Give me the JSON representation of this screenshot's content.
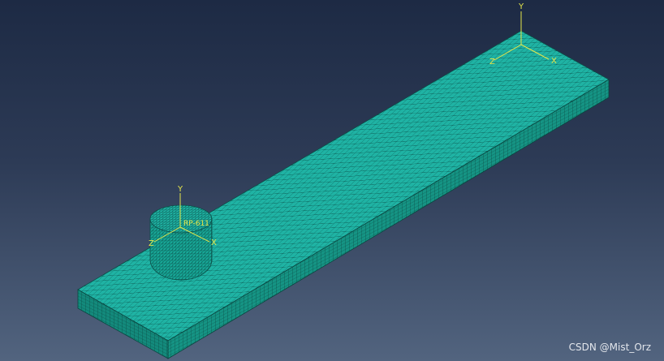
{
  "viewport": {
    "background_top": "#1d2a44",
    "background_bottom": "#52647f"
  },
  "mesh": {
    "color_top": "#1fb3a4",
    "color_side": "#159484",
    "line_color": "#0b4e48"
  },
  "triad_plate": {
    "labels": {
      "y": "Y",
      "x": "X",
      "z": "Z"
    }
  },
  "triad_cylinder": {
    "labels": {
      "y": "Y",
      "x": "X",
      "z": "Z"
    },
    "reference_point": "RP-611"
  },
  "watermark": {
    "text": "CSDN @Mist_Orz"
  },
  "icons": [
    "mesh-plate",
    "mesh-cylinder",
    "coordinate-triad-icon"
  ]
}
